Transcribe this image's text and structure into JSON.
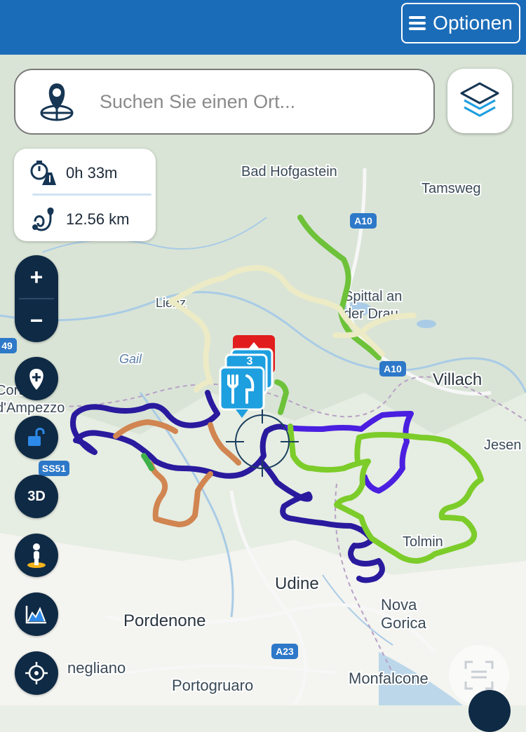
{
  "header": {
    "options_label": "Optionen"
  },
  "search": {
    "placeholder": "Suchen Sie einen Ort..."
  },
  "stats": {
    "duration": "0h 33m",
    "distance": "12.56 km"
  },
  "zoom": {
    "in_label": "+",
    "out_label": "−"
  },
  "buttons": {
    "mode_3d_label": "3D"
  },
  "map": {
    "places": {
      "bad_hofgastein": "Bad Hofgastein",
      "tamsweg": "Tamsweg",
      "spittal_1": "Spittal an",
      "spittal_2": "der Drau",
      "villach": "Villach",
      "lienz": "Lienz",
      "gail": "Gail",
      "cortina_1": "Cortina",
      "cortina_2": "d'Ampezzo",
      "jesenice": "Jesen",
      "tolmin": "Tolmin",
      "udine": "Udine",
      "nova_1": "Nova",
      "nova_2": "Gorica",
      "pordenone": "Pordenone",
      "conegliano": "negliano",
      "portogruaro": "Portogruaro",
      "monfalcone": "Monfalcone"
    },
    "roads": {
      "a10_north": "A10",
      "a10_south": "A10",
      "a23": "A23",
      "ss51": "SS51",
      "road_49": "49"
    },
    "poi_count": "3",
    "route_colors": {
      "lightgreen": "#6ec23a",
      "cream": "#ecebc5",
      "navy": "#2a1a9e",
      "violet": "#4a1fe0",
      "orange": "#d18551",
      "lime": "#7ccc2a",
      "accent": "#1b6cb8"
    }
  }
}
